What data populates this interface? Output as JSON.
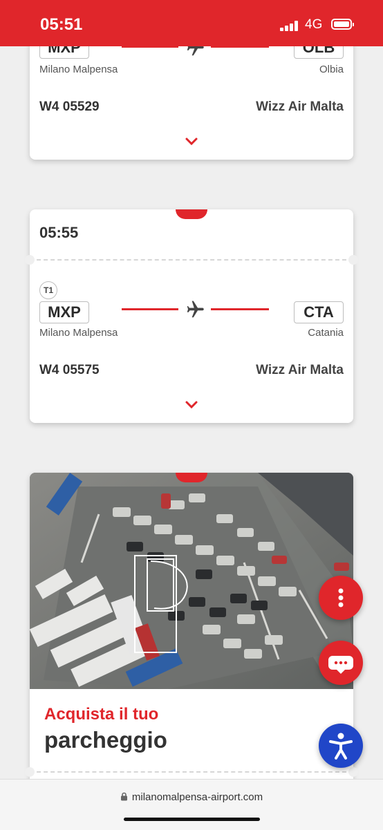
{
  "status": {
    "time": "05:51",
    "network": "4G"
  },
  "flights": [
    {
      "time": "",
      "origin_code": "MXP",
      "origin_city": "Milano Malpensa",
      "dest_code": "OLB",
      "dest_city": "Olbia",
      "flight_number": "W4 05529",
      "airline": "Wizz Air Malta"
    },
    {
      "time": "05:55",
      "terminal": "T1",
      "origin_code": "MXP",
      "origin_city": "Milano Malpensa",
      "dest_code": "CTA",
      "dest_city": "Catania",
      "flight_number": "W4 05575",
      "airline": "Wizz Air Malta"
    }
  ],
  "promo": {
    "kicker": "Acquista il tuo",
    "title": "parcheggio"
  },
  "browser": {
    "url": "milanomalpensa-airport.com"
  },
  "colors": {
    "accent": "#e0262b",
    "a11y": "#2046c8"
  },
  "icons": [
    "plane-icon",
    "chevron-down-icon",
    "more-vertical-icon",
    "chat-icon",
    "accessibility-icon",
    "lock-icon",
    "parking-icon"
  ]
}
